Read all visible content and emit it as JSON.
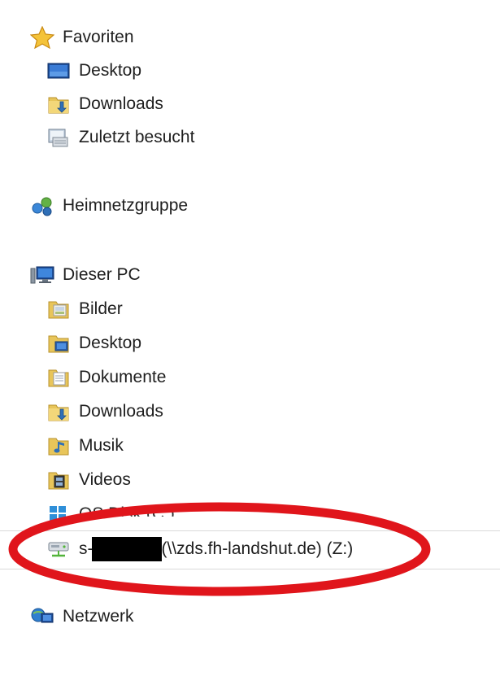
{
  "sidebar": {
    "favorites": {
      "label": "Favoriten",
      "icon": "star-icon",
      "items": [
        {
          "label": "Desktop",
          "icon": "desktop-icon"
        },
        {
          "label": "Downloads",
          "icon": "downloads-folder-icon"
        },
        {
          "label": "Zuletzt besucht",
          "icon": "recent-places-icon"
        }
      ]
    },
    "homegroup": {
      "label": "Heimnetzgruppe",
      "icon": "homegroup-icon"
    },
    "this_pc": {
      "label": "Dieser PC",
      "icon": "computer-icon",
      "items": [
        {
          "label": "Bilder",
          "icon": "pictures-folder-icon"
        },
        {
          "label": "Desktop",
          "icon": "desktop-folder-icon"
        },
        {
          "label": "Dokumente",
          "icon": "documents-folder-icon"
        },
        {
          "label": "Downloads",
          "icon": "downloads-folder-icon"
        },
        {
          "label": "Musik",
          "icon": "music-folder-icon"
        },
        {
          "label": "Videos",
          "icon": "videos-folder-icon"
        },
        {
          "label": "OS Disk (C:)",
          "icon": "windows-drive-icon"
        }
      ],
      "network_drive": {
        "prefix": "s-",
        "suffix": "(\\\\zds.fh-landshut.de) (Z:)",
        "icon": "network-drive-icon"
      }
    },
    "network": {
      "label": "Netzwerk",
      "icon": "network-icon"
    }
  },
  "colors": {
    "annotation_ellipse": "#e0151b",
    "redaction": "#000000",
    "text": "#1e1e1e",
    "folder_yellow": "#e8c55a",
    "accent_blue": "#2f6fb7"
  }
}
